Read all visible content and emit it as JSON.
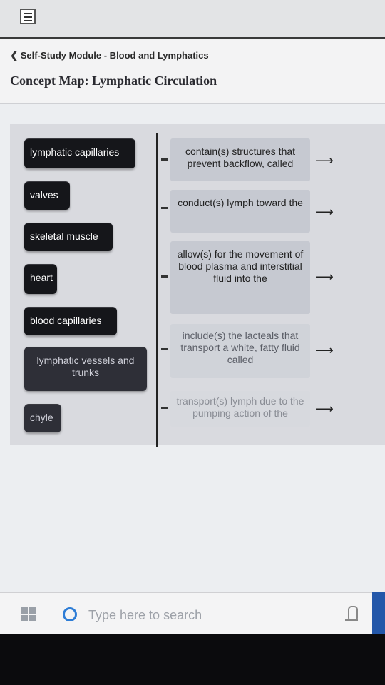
{
  "breadcrumb": {
    "label": "Self-Study Module - Blood and Lymphatics"
  },
  "page": {
    "title": "Concept Map: Lymphatic Circulation"
  },
  "terms": [
    "lymphatic capillaries",
    "valves",
    "skeletal muscle",
    "heart",
    "blood capillaries",
    "lymphatic vessels and trunks",
    "chyle"
  ],
  "descriptions": [
    "contain(s) structures that prevent backflow, called",
    "conduct(s) lymph toward the",
    "allow(s) for the movement of blood plasma and interstitial fluid into the",
    "include(s) the lacteals that transport a white, fatty fluid called",
    "transport(s) lymph due to the pumping action of the"
  ],
  "taskbar": {
    "search_placeholder": "Type here to search"
  },
  "icons": {
    "menu": "hamburger-icon",
    "back": "chevron-left-icon",
    "windows": "windows-start-icon",
    "search": "cortana-circle-icon",
    "mic": "microphone-icon"
  },
  "colors": {
    "term_bg": "#15161a",
    "desc_bg": "#c6c9d1",
    "search_accent": "#2e7dd6"
  }
}
